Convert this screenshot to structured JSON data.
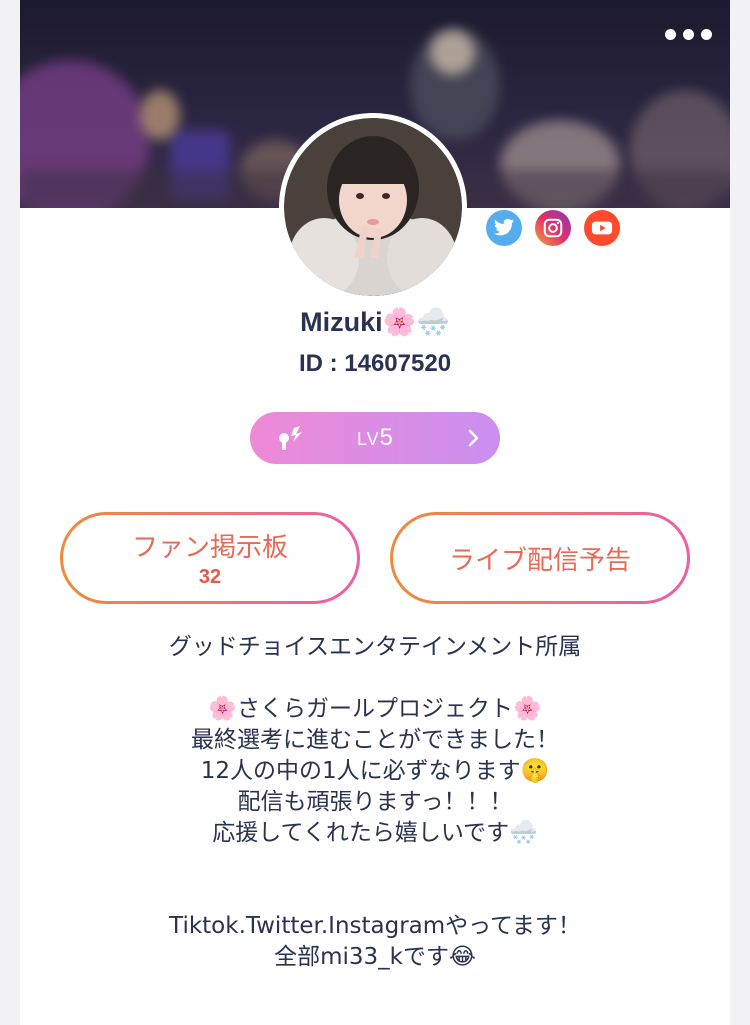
{
  "header": {
    "more_menu_icon": "more-horizontal-icon"
  },
  "profile": {
    "name": "Mizuki🌸🌨️",
    "id_text": "ID : 14607520",
    "social_links": [
      {
        "name": "twitter",
        "icon": "twitter-icon",
        "color": "#55acee"
      },
      {
        "name": "instagram",
        "icon": "instagram-icon",
        "color": "#c13584"
      },
      {
        "name": "youtube",
        "icon": "youtube-icon",
        "color": "#ff3b30"
      }
    ]
  },
  "level": {
    "prefix": "LV",
    "number": "5",
    "icon": "key-icon",
    "chevron_icon": "chevron-right-icon"
  },
  "buttons": {
    "fan_board_label": "ファン掲示板",
    "fan_board_count": "32",
    "live_schedule_label": "ライブ配信予告"
  },
  "bio": {
    "line1": "グッドチョイスエンタテインメント所属",
    "line2": "🌸さくらガールプロジェクト🌸",
    "line3": "最終選考に進むことができました！",
    "line4": "12人の中の1人に必ずなります🤫",
    "line5": "配信も頑張りますっ！！！",
    "line6": "応援してくれたら嬉しいです🌨️",
    "line7": "Tiktok.Twitter.Instagramやってます！",
    "line8": "全部mi33_kです😂"
  },
  "colors": {
    "accent_gradient_start": "#f08a3a",
    "accent_gradient_end": "#ea5fa6",
    "level_gradient_start": "#ee8ad6",
    "level_gradient_end": "#c98ff0",
    "text_dark": "#2b3150"
  }
}
